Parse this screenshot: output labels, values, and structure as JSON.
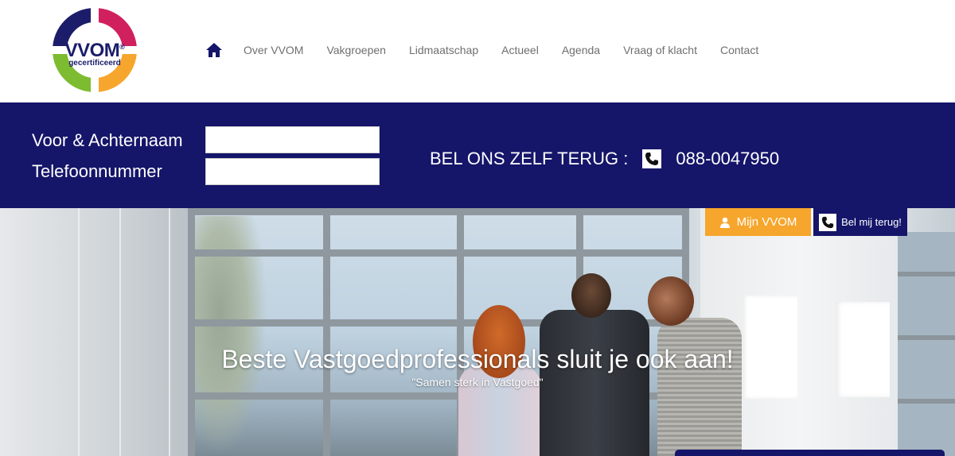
{
  "logo": {
    "brand": "VVOM",
    "reg_mark": "®",
    "tagline": "gecertificeerd"
  },
  "nav": {
    "home_icon": "home-icon",
    "items": [
      {
        "label": "Over VVOM"
      },
      {
        "label": "Vakgroepen"
      },
      {
        "label": "Lidmaatschap"
      },
      {
        "label": "Actueel"
      },
      {
        "label": "Agenda"
      },
      {
        "label": "Vraag of klacht"
      },
      {
        "label": "Contact"
      }
    ]
  },
  "callback": {
    "name_label": "Voor & Achternaam",
    "phone_label": "Telefoonnummer",
    "name_value": "",
    "phone_value": "",
    "call_text": "BEL ONS ZELF TERUG :",
    "phone_icon": "phone-icon",
    "phone_number": "088-0047950"
  },
  "hero": {
    "title": "Beste Vastgoedprofessionals sluit je ook aan!",
    "subtitle": "\"Samen sterk in Vastgoed\""
  },
  "buttons": {
    "mijn_vvom": "Mijn VVOM",
    "bel_mij_terug": "Bel mij terug!"
  },
  "colors": {
    "navy": "#15156a",
    "orange": "#f6a62c",
    "nav_text": "#6f6f6f",
    "logo_red": "#d0215e",
    "logo_green": "#7dbb30",
    "logo_orange": "#f6a62c",
    "logo_navy": "#1b1d6a"
  }
}
